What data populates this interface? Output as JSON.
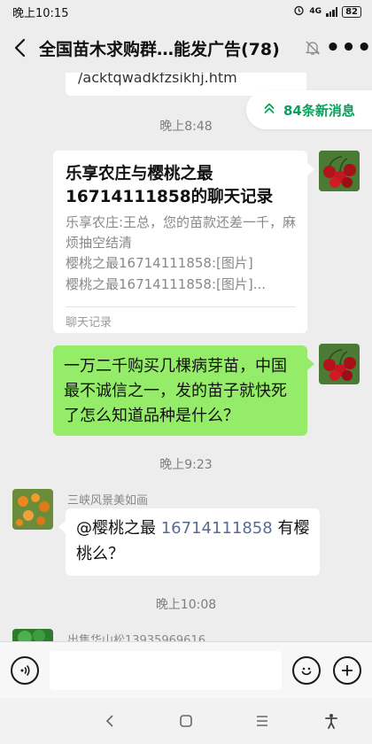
{
  "status": {
    "time": "晚上10:15",
    "network": "4G",
    "battery": "82"
  },
  "header": {
    "title": "全国苗木求购群…能发广告(78)",
    "back_icon": "back-arrow-icon",
    "mute_icon": "bell-off-icon",
    "more_icon": "more-icon"
  },
  "new_messages": {
    "label": "84条新消息"
  },
  "messages": {
    "link_fragment": "/acktqwadkfzsikhj.htm",
    "time1": "晚上8:48",
    "record_title": "乐享农庄与樱桃之最16714111858的聊天记录",
    "record_line1": "乐享农庄:王总，您的苗款还差一千，麻烦抽空结清",
    "record_line2": "樱桃之最16714111858:[图片]",
    "record_line3": "樱桃之最16714111858:[图片]...",
    "record_footer": "聊天记录",
    "green_text": "一万二千购买几棵病芽苗，中国最不诚信之一，发的苗子就快死了怎么知道品种是什么？",
    "time2": "晚上9:23",
    "sender_name": "三峡风景美如画",
    "mention_prefix": "@樱桃之最",
    "mention_phone": "16714111858",
    "mention_suffix": "有樱桃么？",
    "time3": "晚上10:08",
    "next_sender": "出售华山松13935969616"
  },
  "colors": {
    "green_bubble": "#95ec69",
    "new_msg_accent": "#07a05a",
    "link_blue": "#576b95",
    "background": "#ededed"
  }
}
